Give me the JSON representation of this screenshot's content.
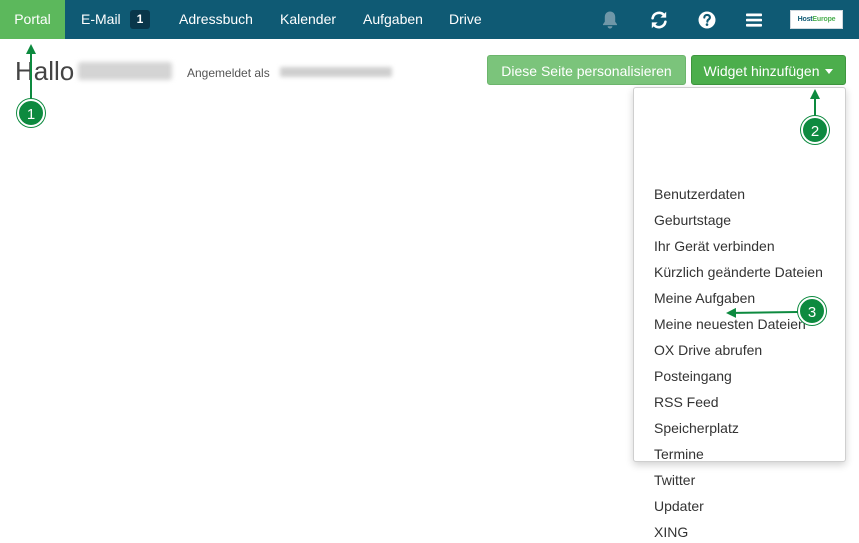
{
  "nav": {
    "portal": "Portal",
    "email": "E-Mail",
    "email_badge": "1",
    "addressbook": "Adressbuch",
    "calendar": "Kalender",
    "tasks": "Aufgaben",
    "drive": "Drive"
  },
  "header_icons": [
    "bell-icon",
    "refresh-icon",
    "help-icon",
    "menu-icon"
  ],
  "logo": {
    "text_a": "Host",
    "text_b": "Europe"
  },
  "greeting": {
    "hello": "Hallo",
    "logged_in_as": "Angemeldet als"
  },
  "buttons": {
    "personalize": "Diese Seite personalisieren",
    "add_widget": "Widget hinzufügen"
  },
  "dropdown_items": [
    "Benutzerdaten",
    "Geburtstage",
    "Ihr Gerät verbinden",
    "Kürzlich geänderte Dateien",
    "Meine Aufgaben",
    "Meine neuesten Dateien",
    "OX Drive abrufen",
    "Posteingang",
    "RSS Feed",
    "Speicherplatz",
    "Termine",
    "Twitter",
    "Updater",
    "XING"
  ],
  "markers": [
    "1",
    "2",
    "3"
  ],
  "colors": {
    "topbar": "#0f5a74",
    "active_tab": "#5cb85c",
    "primary_button": "#4cae4c",
    "marker": "#0d8a3f"
  }
}
